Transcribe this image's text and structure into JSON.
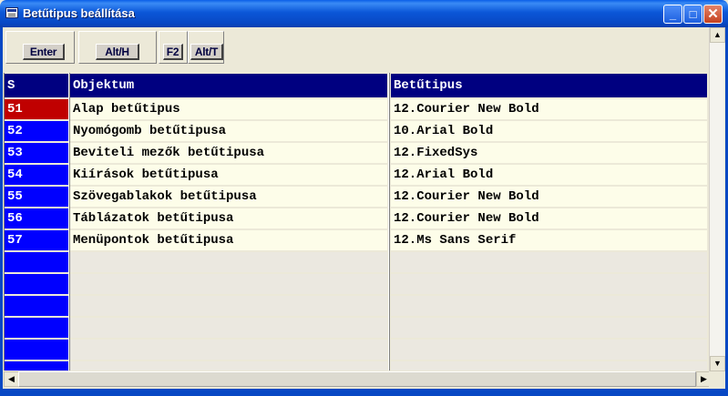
{
  "window": {
    "title": "Betűtipus beállítása"
  },
  "titlebar_buttons": {
    "minimize": "_",
    "maximize": "□",
    "close": "✕"
  },
  "toolbar": {
    "buttons": [
      "Enter",
      "Alt/H",
      "F2",
      "Alt/T"
    ]
  },
  "table": {
    "headers": [
      "S",
      "Objektum",
      "Betűtipus"
    ],
    "rows": [
      {
        "s": "51",
        "objektum": "Alap betűtipus",
        "betutipus": "12.Courier New Bold",
        "selected": true
      },
      {
        "s": "52",
        "objektum": "Nyomógomb betűtipusa",
        "betutipus": "10.Arial Bold"
      },
      {
        "s": "53",
        "objektum": "Beviteli mezők betűtipusa",
        "betutipus": "12.FixedSys"
      },
      {
        "s": "54",
        "objektum": "Kiírások betűtipusa",
        "betutipus": "12.Arial Bold"
      },
      {
        "s": "55",
        "objektum": "Szövegablakok betűtipusa",
        "betutipus": "12.Courier New Bold"
      },
      {
        "s": "56",
        "objektum": "Táblázatok betűtipusa",
        "betutipus": "12.Courier New Bold"
      },
      {
        "s": "57",
        "objektum": "Menüpontok betűtipusa",
        "betutipus": "12.Ms Sans Serif"
      }
    ],
    "empty_rows": 6
  },
  "scrollbars": {
    "up": "▲",
    "down": "▼",
    "left": "◀",
    "right": "▶"
  },
  "colors": {
    "titlebar": "#0a56d8",
    "header_bg": "#000080",
    "s_col": "#0000ff",
    "selected": "#c00000",
    "cell_bg": "#fdfde9"
  }
}
